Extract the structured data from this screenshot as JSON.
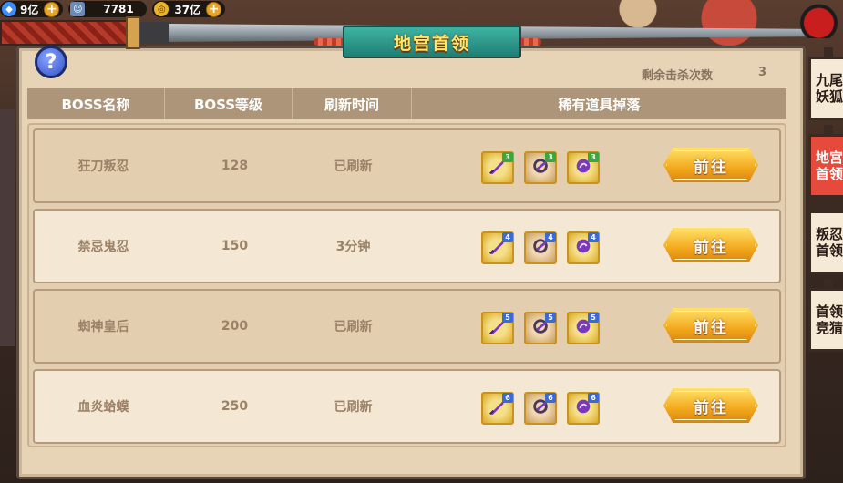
{
  "resources": [
    {
      "icon": "gem-icon",
      "value": "9亿"
    },
    {
      "icon": "character-icon",
      "value": "7781"
    },
    {
      "icon": "coin-icon",
      "value": "37亿"
    }
  ],
  "title": "地宫首领",
  "kills_label": "剩余击杀次数",
  "kills_value": "3",
  "headers": [
    "BOSS名称",
    "BOSS等级",
    "刷新时间",
    "稀有道具掉落"
  ],
  "go_label": "前往",
  "rows": [
    {
      "name": "狂刀叛忍",
      "level": "128",
      "refresh": "已刷新",
      "drops": [
        {
          "type": "sword",
          "badge": "3"
        },
        {
          "type": "arm",
          "badge": "3"
        },
        {
          "type": "orb",
          "badge": "3"
        }
      ]
    },
    {
      "name": "禁忌鬼忍",
      "level": "150",
      "refresh": "3分钟",
      "drops": [
        {
          "type": "sword",
          "badge": "4"
        },
        {
          "type": "arm",
          "badge": "4"
        },
        {
          "type": "orb",
          "badge": "4"
        }
      ]
    },
    {
      "name": "蜘神皇后",
      "level": "200",
      "refresh": "已刷新",
      "drops": [
        {
          "type": "sword",
          "badge": "5"
        },
        {
          "type": "arm",
          "badge": "5"
        },
        {
          "type": "orb",
          "badge": "5"
        }
      ]
    },
    {
      "name": "血炎蛤蟆",
      "level": "250",
      "refresh": "已刷新",
      "drops": [
        {
          "type": "sword",
          "badge": "6"
        },
        {
          "type": "arm",
          "badge": "6"
        },
        {
          "type": "orb",
          "badge": "6"
        }
      ]
    }
  ],
  "badge_colors": {
    "3": "#3aa640",
    "4": "#3a6ad8",
    "5": "#3a6ad8",
    "6": "#3a6ad8"
  },
  "side_tabs": [
    {
      "label": "九尾妖狐",
      "active": false
    },
    {
      "label": "地宫首领",
      "active": true
    },
    {
      "label": "叛忍首领",
      "active": false
    },
    {
      "label": "首领竞猜",
      "active": false
    }
  ]
}
